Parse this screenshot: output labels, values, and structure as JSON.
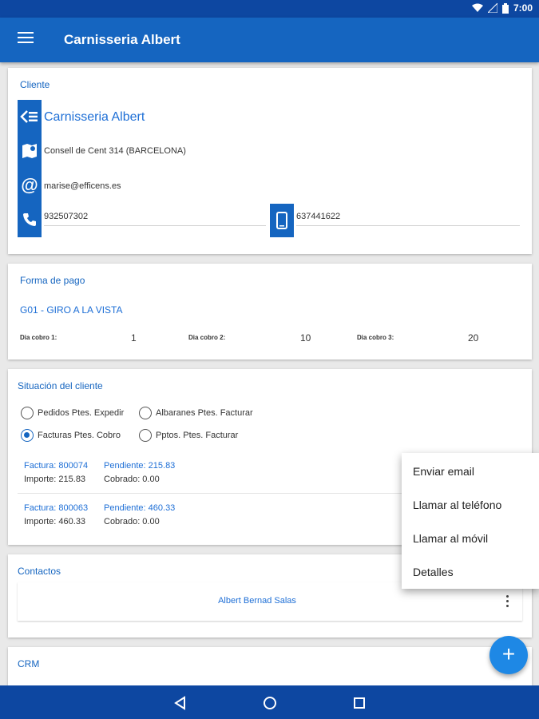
{
  "status_bar": {
    "time": "7:00"
  },
  "app_bar": {
    "title": "Carnisseria Albert"
  },
  "cliente": {
    "section_title": "Cliente",
    "name": "Carnisseria Albert",
    "address": "Consell de Cent 314 (BARCELONA)",
    "email": "marise@efficens.es",
    "phone": "932507302",
    "mobile": "637441622"
  },
  "forma_pago": {
    "section_title": "Forma de pago",
    "name": "G01 - GIRO A LA VISTA",
    "dias": [
      {
        "label": "Dia cobro 1:",
        "value": "1"
      },
      {
        "label": "Dia cobro 2:",
        "value": "10"
      },
      {
        "label": "Dia cobro 3:",
        "value": "20"
      }
    ]
  },
  "situacion": {
    "section_title": "Situación del cliente",
    "options": [
      {
        "label": "Pedidos Ptes. Expedir",
        "selected": false
      },
      {
        "label": "Albaranes Ptes. Facturar",
        "selected": false
      },
      {
        "label": "Facturas Ptes. Cobro",
        "selected": true
      },
      {
        "label": "Pptos. Ptes. Facturar",
        "selected": false
      }
    ],
    "invoices": [
      {
        "factura": "Factura: 800074",
        "pendiente": "Pendiente: 215.83",
        "importe": "Importe: 215.83",
        "cobrado": "Cobrado: 0.00"
      },
      {
        "factura": "Factura: 800063",
        "pendiente": "Pendiente: 460.33",
        "importe": "Importe: 460.33",
        "cobrado": "Cobrado: 0.00"
      }
    ]
  },
  "contactos": {
    "section_title": "Contactos",
    "items": [
      {
        "name": "Albert Bernad Salas"
      }
    ]
  },
  "crm": {
    "section_title": "CRM"
  },
  "popup_menu": {
    "items": [
      {
        "label": "Enviar email"
      },
      {
        "label": "Llamar al teléfono"
      },
      {
        "label": "Llamar al móvil"
      },
      {
        "label": "Detalles"
      }
    ]
  },
  "fab": {
    "icon": "plus-icon",
    "label": "+"
  },
  "colors": {
    "primary": "#1565c0",
    "primary_dark": "#0d47a1",
    "accent": "#1e88e5",
    "link": "#1e6fd6"
  }
}
